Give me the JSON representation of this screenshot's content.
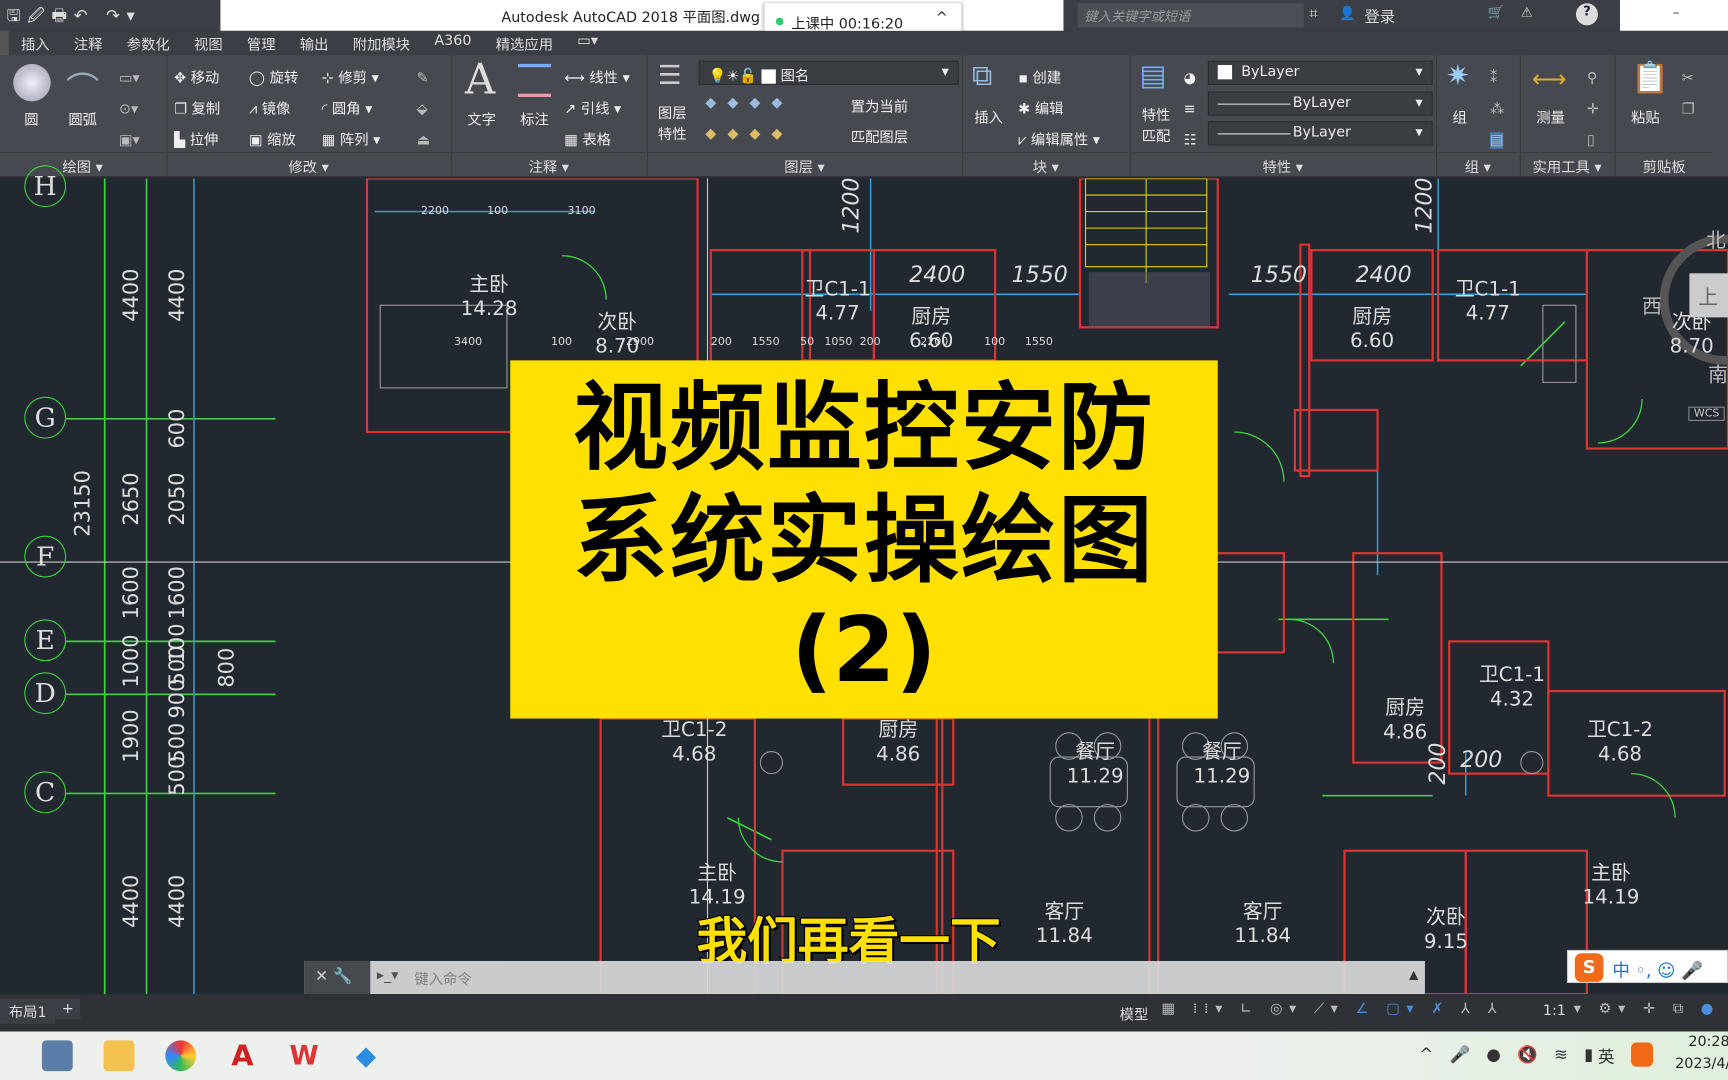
{
  "titlebar": {
    "app_title": "Autodesk AutoCAD 2018    平面图.dwg",
    "recording": "上课中 00:16:20",
    "search_placeholder": "键入关键字或短语",
    "login": "登录"
  },
  "tabs": [
    "插入",
    "注释",
    "参数化",
    "视图",
    "管理",
    "输出",
    "附加模块",
    "A360",
    "精选应用"
  ],
  "ribbon": {
    "draw": {
      "circle": "圆",
      "arc": "圆弧",
      "panel": "绘图 ▾"
    },
    "modify": {
      "move": "移动",
      "rotate": "旋转",
      "trim": "修剪",
      "copy": "复制",
      "mirror": "镜像",
      "fillet": "圆角",
      "stretch": "拉伸",
      "scale": "缩放",
      "array": "阵列",
      "panel": "修改 ▾"
    },
    "annotation": {
      "text": "文字",
      "dimension": "标注",
      "linear": "线性",
      "leader": "引线",
      "table": "表格",
      "panel": "注释 ▾"
    },
    "layers": {
      "layer_props": "图层\n特性",
      "layer_name": "图名",
      "set_current": "置为当前",
      "match_layer": "匹配图层",
      "panel": "图层 ▾"
    },
    "block": {
      "insert": "插入",
      "create": "创建",
      "edit": "编辑",
      "edit_attr": "编辑属性",
      "panel": "块 ▾"
    },
    "properties": {
      "match": "特性\n匹配",
      "color": "ByLayer",
      "linetype": "ByLayer",
      "lineweight": "ByLayer",
      "panel": "特性 ▾"
    },
    "groups": {
      "group": "组",
      "panel": "组 ▾"
    },
    "utilities": {
      "measure": "测量",
      "panel": "实用工具 ▾"
    },
    "clipboard": {
      "paste": "粘贴",
      "panel": "剪贴板"
    }
  },
  "drawing": {
    "axes": [
      "H",
      "G",
      "F",
      "E",
      "D",
      "C"
    ],
    "dims_left": [
      "4400",
      "4400",
      "23150",
      "2650",
      "2050",
      "600",
      "1600",
      "1600",
      "100",
      "1000",
      "500",
      "800",
      "1900",
      "900",
      "500",
      "500",
      "4400",
      "4400"
    ],
    "top_dims": [
      "2200",
      "100",
      "3100",
      "3400",
      "100",
      "2900",
      "200",
      "1550",
      "50",
      "1050",
      "200",
      "2200",
      "100",
      "1550"
    ],
    "italic_dims": [
      "1200",
      "2400",
      "1550",
      "1550",
      "2400",
      "1200",
      "200",
      "200"
    ],
    "rooms": [
      {
        "name": "主卧",
        "area": "14.28"
      },
      {
        "name": "次卧",
        "area": "8.70"
      },
      {
        "name": "卫C1-1",
        "area": "4.77"
      },
      {
        "name": "厨房",
        "area": "6.60"
      },
      {
        "name": "厨房",
        "area": "6.60"
      },
      {
        "name": "卫C1-1",
        "area": "4.77"
      },
      {
        "name": "次卧",
        "area": "8.70"
      },
      {
        "name": "卫C1-2",
        "area": "4.68"
      },
      {
        "name": "厨房",
        "area": "4.86"
      },
      {
        "name": "餐厅",
        "area": "11.29"
      },
      {
        "name": "餐厅",
        "area": "11.29"
      },
      {
        "name": "厨房",
        "area": "4.86"
      },
      {
        "name": "卫C1-1",
        "area": "4.32"
      },
      {
        "name": "卫C1-2",
        "area": "4.68"
      },
      {
        "name": "主卧",
        "area": "14.19"
      },
      {
        "name": "客厅",
        "area": "11.84"
      },
      {
        "name": "客厅",
        "area": "11.84"
      },
      {
        "name": "次卧",
        "area": "9.15"
      },
      {
        "name": "主卧",
        "area": "14.19"
      }
    ],
    "viewcube": {
      "north": "北",
      "west": "西",
      "south": "南",
      "top": "上",
      "wcs": "WCS"
    }
  },
  "overlay": {
    "line1": "视频监控安防",
    "line2": "系统实操绘图",
    "line3": "(2)",
    "color": "#ffe000"
  },
  "subtitle": "我们再看一下",
  "command": {
    "placeholder": "键入命令"
  },
  "status": {
    "layout_tab": "布局1",
    "add": "+",
    "model": "模型",
    "scale": "1:1"
  },
  "ime": {
    "label": "中 ◦, ☺ 🎤"
  },
  "taskbar": {
    "time": "20:28",
    "date": "2023/4/",
    "lang": "英"
  }
}
